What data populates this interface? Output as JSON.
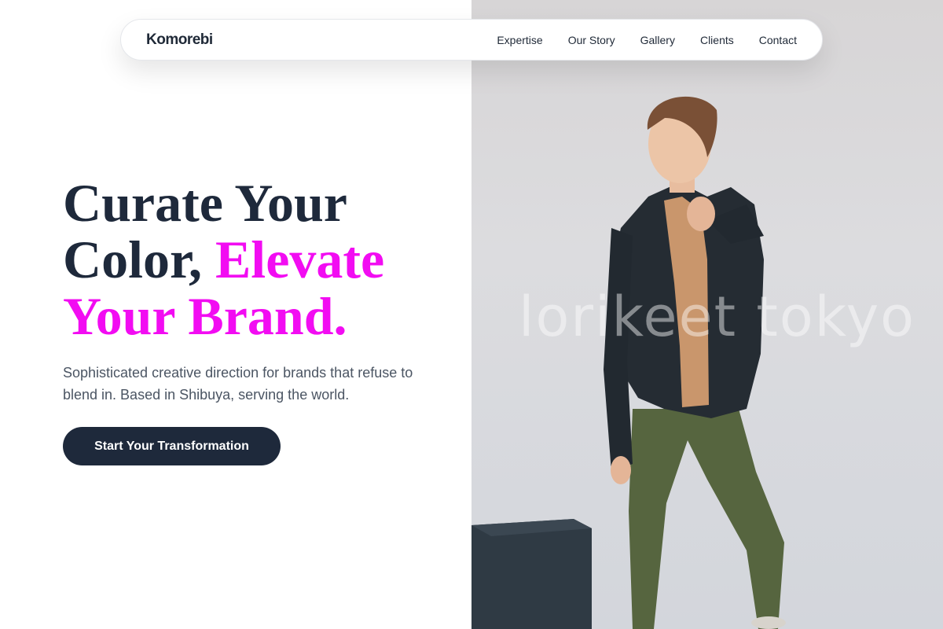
{
  "nav": {
    "brand": "Komorebi",
    "links": [
      "Expertise",
      "Our Story",
      "Gallery",
      "Clients",
      "Contact"
    ]
  },
  "hero": {
    "title_line1": "Curate Your",
    "title_line2a": "Color, ",
    "title_line2b": "Elevate",
    "title_line3": "Your Brand.",
    "subtitle": "Sophisticated creative direction for brands that refuse to blend in. Based in Shibuya, serving the world.",
    "cta_label": "Start Your Transformation"
  },
  "photo": {
    "watermark": "lorikeet tokyo"
  },
  "colors": {
    "accent": "#f20cf2",
    "dark": "#1e293b",
    "text_muted": "#4b5563"
  }
}
